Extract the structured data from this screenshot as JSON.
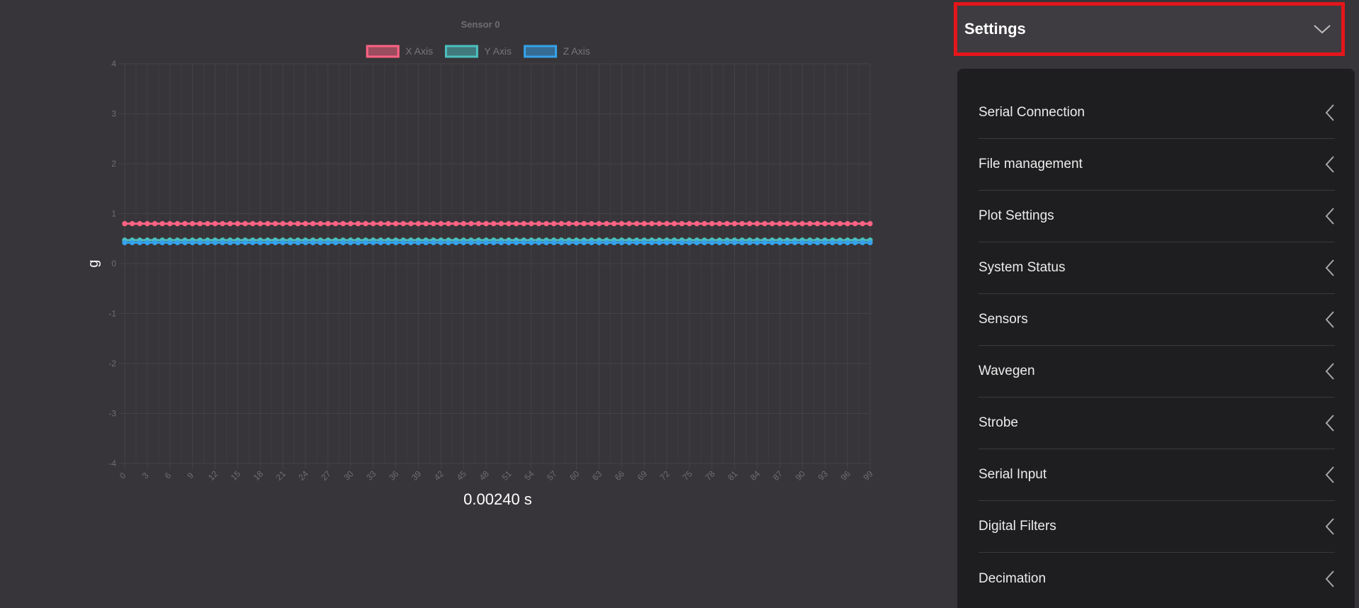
{
  "chart_data": {
    "type": "line",
    "title": "Sensor 0",
    "ylabel": "g",
    "xlabel": "",
    "ylim": [
      -4,
      4
    ],
    "xlim": [
      0,
      99
    ],
    "yticks": [
      4,
      3,
      2,
      1,
      0,
      -1,
      -2,
      -3,
      -4
    ],
    "xticks": [
      0,
      3,
      6,
      9,
      12,
      15,
      18,
      21,
      24,
      27,
      30,
      33,
      36,
      39,
      42,
      45,
      48,
      51,
      54,
      57,
      60,
      63,
      66,
      69,
      72,
      75,
      78,
      81,
      84,
      87,
      90,
      93,
      96,
      99
    ],
    "grid": true,
    "legend_position": "top",
    "series": [
      {
        "name": "X Axis",
        "color": "#ff6384",
        "value": 0.8,
        "num_points": 100
      },
      {
        "name": "Y Axis",
        "color": "#4bc0c0",
        "value": 0.47,
        "num_points": 100
      },
      {
        "name": "Z Axis",
        "color": "#36a2eb",
        "value": 0.42,
        "num_points": 100
      }
    ]
  },
  "time_readout": "0.00240 s",
  "settings": {
    "title": "Settings",
    "chevron_icon": "chevron-down-icon",
    "highlight_color": "#e3161b",
    "items": [
      {
        "label": "Serial Connection",
        "icon": "chevron-left-icon"
      },
      {
        "label": "File management",
        "icon": "chevron-left-icon"
      },
      {
        "label": "Plot Settings",
        "icon": "chevron-left-icon"
      },
      {
        "label": "System Status",
        "icon": "chevron-left-icon"
      },
      {
        "label": "Sensors",
        "icon": "chevron-left-icon"
      },
      {
        "label": "Wavegen",
        "icon": "chevron-left-icon"
      },
      {
        "label": "Strobe",
        "icon": "chevron-left-icon"
      },
      {
        "label": "Serial Input",
        "icon": "chevron-left-icon"
      },
      {
        "label": "Digital Filters",
        "icon": "chevron-left-icon"
      },
      {
        "label": "Decimation",
        "icon": "chevron-left-icon"
      }
    ]
  }
}
